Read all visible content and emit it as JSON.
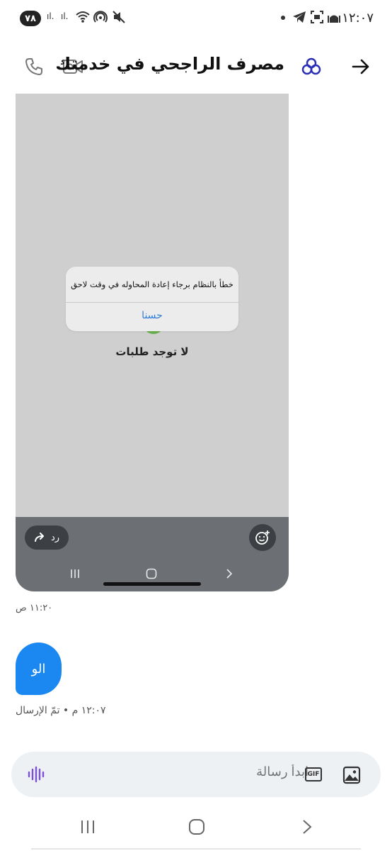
{
  "status_bar": {
    "battery": "٧٨",
    "signal_1": "ıl.",
    "signal_2": "ıl.",
    "time": "١٢:٠٧"
  },
  "header": {
    "title": "مصرف الراجحي في خدمتك",
    "back_icon": "arrow-right-icon",
    "video_icon": "video-camera-icon",
    "call_icon": "phone-icon",
    "logo_icon": "alrajhi-logo-icon"
  },
  "shared_screenshot": {
    "dialog_message": "خطأ بالنظام برجاء إعادة المحاوله في وقت لاحق",
    "dialog_button": "حسنا",
    "empty_label": "لا توجد طلبات",
    "reply_label": "رد",
    "emoji_icon": "emoji-add-icon"
  },
  "messages": [
    {
      "time": "١١:٢٠ ص"
    },
    {
      "text": "الو",
      "status": "١٢:٠٧ م • تمّ الإرسال"
    }
  ],
  "composer": {
    "placeholder": "ابدأ رسالة",
    "gif_label": "GIF",
    "image_icon": "image-icon",
    "voice_icon": "voice-wave-icon"
  },
  "colors": {
    "bubble": "#1a88f0",
    "dialog_button": "#2f7cd8",
    "logo": "#2a2fb5",
    "voice": "#7b4fd6"
  }
}
